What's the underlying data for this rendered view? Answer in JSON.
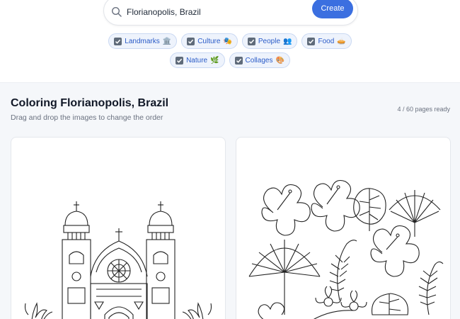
{
  "search": {
    "value": "Florianopolis, Brazil",
    "create_label": "Create",
    "icon": "search-icon"
  },
  "chips": [
    {
      "label": "Landmarks",
      "emoji": "🏛️",
      "checked": true
    },
    {
      "label": "Culture",
      "emoji": "🎭",
      "checked": true
    },
    {
      "label": "People",
      "emoji": "👥",
      "checked": true
    },
    {
      "label": "Food",
      "emoji": "🥧",
      "checked": true
    },
    {
      "label": "Nature",
      "emoji": "🌿",
      "checked": true
    },
    {
      "label": "Collages",
      "emoji": "🎨",
      "checked": true
    }
  ],
  "main": {
    "title": "Coloring Florianopolis, Brazil",
    "subtitle": "Drag and drop the images to change the order",
    "status": "4 / 60 pages ready"
  },
  "colors": {
    "accent": "#3b6fe0",
    "chip_bg": "#eef3fc",
    "chip_text": "#2a5bc7",
    "main_bg": "#f5f7fa"
  }
}
